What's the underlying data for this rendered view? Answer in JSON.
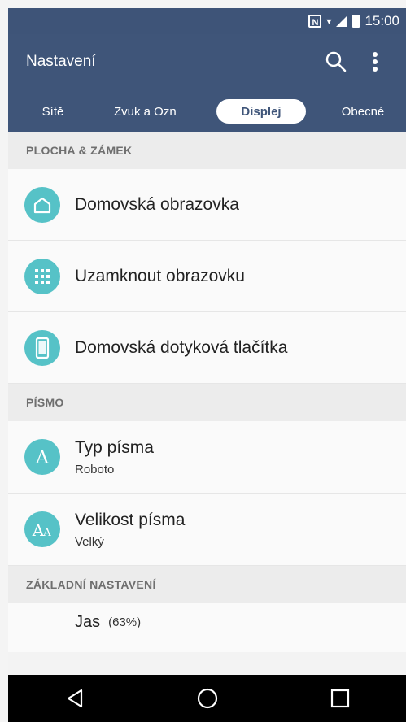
{
  "status_bar": {
    "time": "15:00"
  },
  "app_bar": {
    "title": "Nastavení",
    "icons": [
      "search-icon",
      "more-vert-icon"
    ]
  },
  "tabs": [
    {
      "label": "Sítě",
      "active": false
    },
    {
      "label": "Zvuk a Ozn",
      "active": false
    },
    {
      "label": "Displej",
      "active": true
    },
    {
      "label": "Obecné",
      "active": false
    }
  ],
  "sections": {
    "plocha": {
      "header": "PLOCHA & ZÁMEK",
      "items": [
        {
          "title": "Domovská obrazovka",
          "icon": "home-icon"
        },
        {
          "title": "Uzamknout obrazovku",
          "icon": "grid-lock-icon"
        },
        {
          "title": "Domovská dotyková tlačítka",
          "icon": "phone-icon"
        }
      ]
    },
    "pismo": {
      "header": "PÍSMO",
      "items": [
        {
          "title": "Typ písma",
          "subtitle": "Roboto",
          "icon": "font-type-icon"
        },
        {
          "title": "Velikost písma",
          "subtitle": "Velký",
          "icon": "font-size-icon"
        }
      ]
    },
    "zakladni": {
      "header": "ZÁKLADNÍ NASTAVENÍ",
      "jas": {
        "title": "Jas",
        "value": "(63%)"
      }
    }
  },
  "colors": {
    "primary": "#3f5579",
    "accent": "#56c2c7",
    "nav": "#000000"
  },
  "nav_bar": [
    "back-icon",
    "home-circle-icon",
    "recents-icon"
  ]
}
